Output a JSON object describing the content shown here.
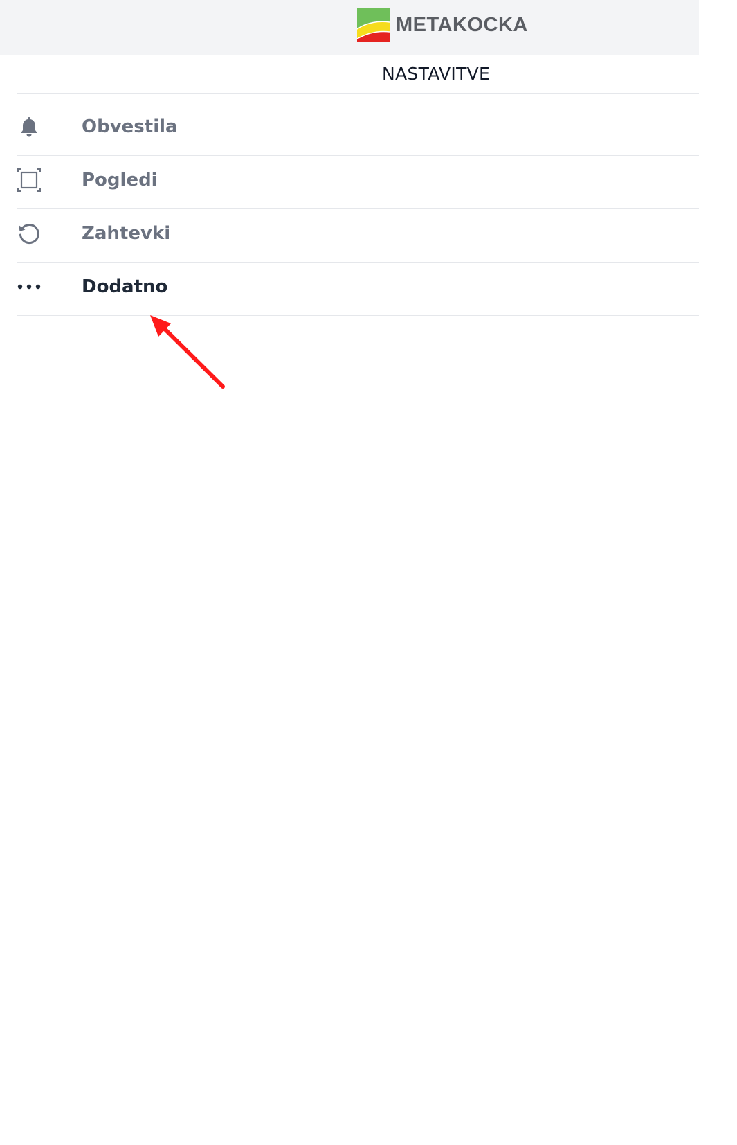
{
  "brand": {
    "name": "METAKOCKA",
    "colors": {
      "green": "#6fbf5a",
      "yellow": "#f6dc1c",
      "red": "#e52421"
    }
  },
  "page_title": "NASTAVITVE",
  "menu": {
    "items": [
      {
        "label": "Obvestila",
        "icon": "bell-icon",
        "active": false
      },
      {
        "label": "Pogledi",
        "icon": "frame-icon",
        "active": false
      },
      {
        "label": "Zahtevki",
        "icon": "refresh-icon",
        "active": false
      },
      {
        "label": "Dodatno",
        "icon": "more-dots-icon",
        "active": true
      }
    ]
  },
  "annotation": {
    "type": "arrow",
    "color": "#ff1a1a",
    "points_to": "Dodatno"
  }
}
